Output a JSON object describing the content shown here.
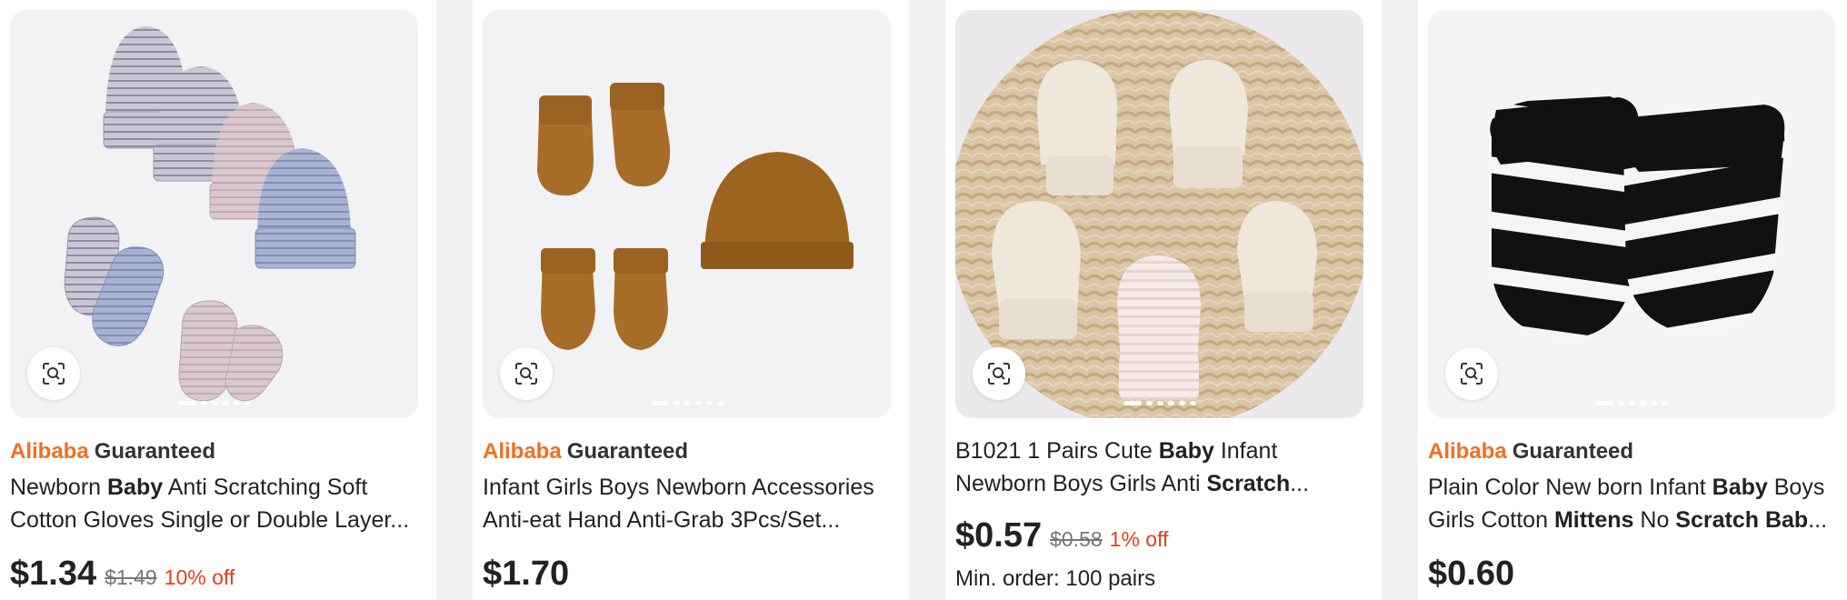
{
  "products": [
    {
      "badge": {
        "brand": "Alibaba",
        "word": "Guaranteed"
      },
      "title_line1": [
        "Newborn ",
        "Baby",
        " Anti Scratching Soft"
      ],
      "title_line2": [
        "Cotton Gloves Single or Double Layer..."
      ],
      "price": "$1.34",
      "old_price": "$1.49",
      "discount": "10% off"
    },
    {
      "badge": {
        "brand": "Alibaba",
        "word": "Guaranteed"
      },
      "title_line1": [
        "Infant Girls Boys Newborn Accessories"
      ],
      "title_line2": [
        "Anti-eat Hand Anti-Grab 3Pcs/Set..."
      ],
      "price": "$1.70"
    },
    {
      "title_line1": [
        "B1021 1 Pairs Cute ",
        "Baby",
        " Infant"
      ],
      "title_line2": [
        "Newborn Boys Girls Anti ",
        "Scratch",
        "..."
      ],
      "price": "$0.57",
      "old_price": "$0.58",
      "discount": "1% off",
      "moq": "Min. order: 100 pairs"
    },
    {
      "badge": {
        "brand": "Alibaba",
        "word": "Guaranteed"
      },
      "title_line1": [
        "Plain Color New born Infant ",
        "Baby",
        " Boys"
      ],
      "title_line2": [
        "Girls Cotton ",
        "Mittens",
        " No ",
        "Scratch",
        " ",
        "Bab",
        "..."
      ],
      "price": "$0.60"
    }
  ],
  "icons": {
    "image_search": "lens-scan-icon"
  }
}
